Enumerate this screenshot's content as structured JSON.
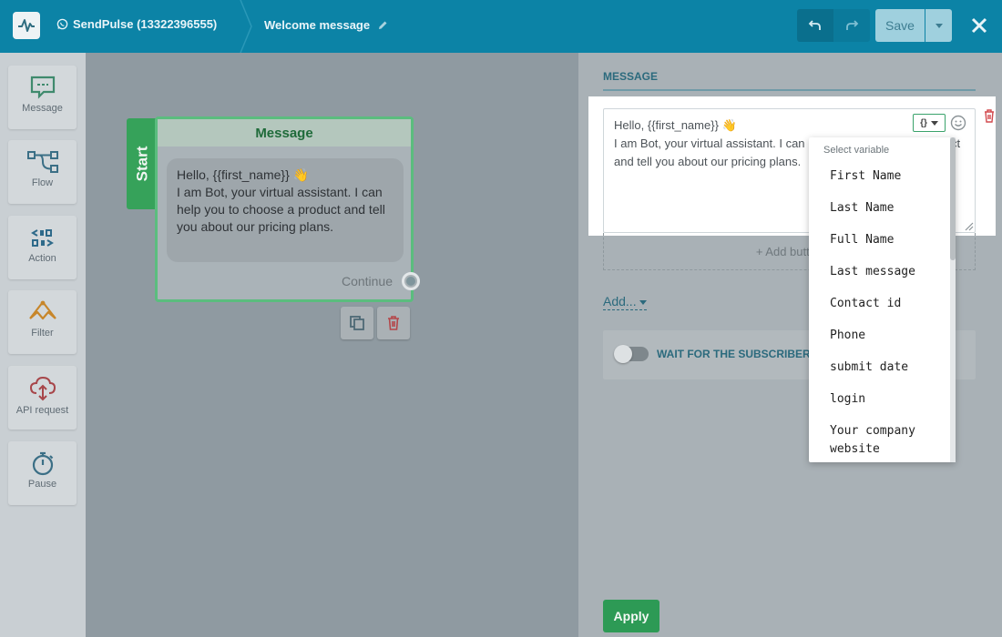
{
  "topbar": {
    "bot_name": "SendPulse (13322396555)",
    "flow_title": "Welcome message",
    "save_label": "Save"
  },
  "toolbar": {
    "items": [
      {
        "label": "Message",
        "icon": "message-icon"
      },
      {
        "label": "Flow",
        "icon": "flow-icon"
      },
      {
        "label": "Action",
        "icon": "action-icon"
      },
      {
        "label": "Filter",
        "icon": "filter-icon"
      },
      {
        "label": "API request",
        "icon": "cloud-api-icon"
      },
      {
        "label": "Pause",
        "icon": "stopwatch-icon"
      }
    ]
  },
  "canvas": {
    "start_label": "Start",
    "node": {
      "title": "Message",
      "text_line1": "Hello,  {{first_name}} 👋",
      "text_line2": "I am Bot, your virtual assistant. I can help you to choose a product and tell you about our pricing plans.",
      "continue_label": "Continue"
    }
  },
  "panel": {
    "section_title": "MESSAGE",
    "message_line1": "Hello,  {{first_name}} 👋",
    "message_line2": "I am Bot, your virtual assistant. I can help you to choose a product and tell you about our pricing plans.",
    "add_button_label": "+ Add button",
    "add_link": "Add...",
    "wait_label": "WAIT FOR THE SUBSCRIBER'S REPLY",
    "apply_label": "Apply"
  },
  "variable_dropdown": {
    "header": "Select variable",
    "items": [
      "First Name",
      "Last Name",
      "Full Name",
      "Last message",
      "Contact id",
      "Phone",
      "submit date",
      "login",
      "Your company website"
    ]
  },
  "colors": {
    "topbar": "#0c83a6",
    "accent_green": "#2d9a55",
    "link_blue": "#2b6a7d"
  }
}
